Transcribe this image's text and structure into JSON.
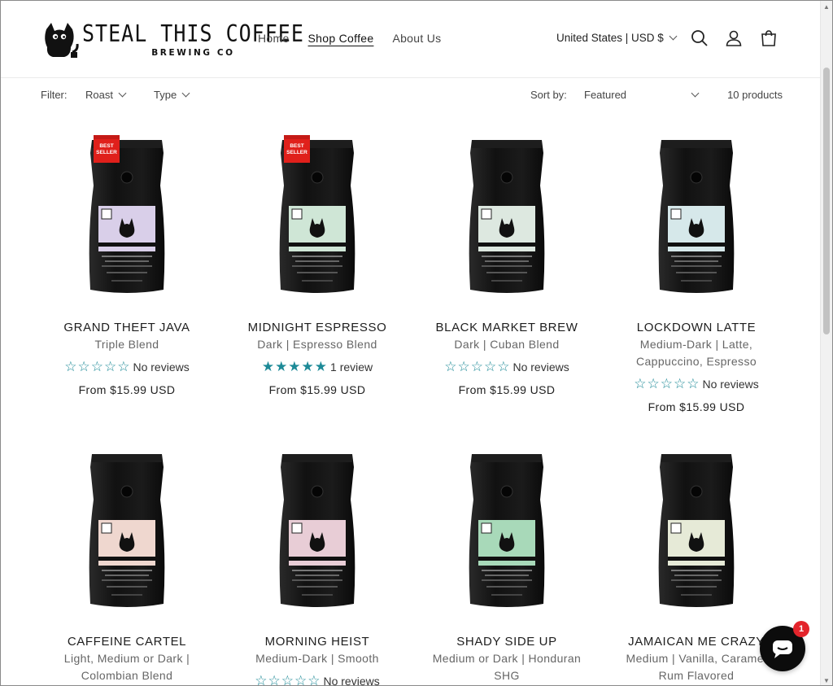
{
  "brand": {
    "title": "STEAL THIS COFFEE",
    "subtitle": "BREWING CO"
  },
  "nav": [
    {
      "label": "Home",
      "active": false
    },
    {
      "label": "Shop Coffee",
      "active": true
    },
    {
      "label": "About Us",
      "active": false
    }
  ],
  "header": {
    "locale": "United States | USD $",
    "icons": [
      "search-icon",
      "account-icon",
      "cart-icon"
    ]
  },
  "filters": {
    "label": "Filter:",
    "roast": "Roast",
    "type": "Type",
    "sort_label": "Sort by:",
    "sort_value": "Featured",
    "count": "10 products"
  },
  "products": [
    {
      "name": "GRAND THEFT JAVA",
      "line1": "Triple Blend",
      "line2": "",
      "stars": "☆☆☆☆☆",
      "reviews": "No reviews",
      "price": "From $15.99 USD",
      "badge": "BEST SELLER",
      "label_color": "#d9cfe9",
      "label_text": "GRAND THEFT JAVA"
    },
    {
      "name": "MIDNIGHT ESPRESSO",
      "line1": "Dark | Espresso Blend",
      "line2": "",
      "stars": "★★★★★",
      "reviews": "1 review",
      "price": "From $15.99 USD",
      "badge": "BEST SELLER",
      "label_color": "#cfe6d6",
      "label_text": "MIDNIGHT ESPRESSO"
    },
    {
      "name": "BLACK MARKET BREW",
      "line1": "Dark | Cuban Blend",
      "line2": "",
      "stars": "☆☆☆☆☆",
      "reviews": "No reviews",
      "price": "From $15.99 USD",
      "badge": "",
      "label_color": "#dde8e0",
      "label_text": "BLACK MARKET BREW"
    },
    {
      "name": "LOCKDOWN LATTE",
      "line1": "Medium-Dark | Latte,",
      "line2": "Cappuccino, Espresso",
      "stars": "☆☆☆☆☆",
      "reviews": "No reviews",
      "price": "From $15.99 USD",
      "badge": "",
      "label_color": "#d6e8ea",
      "label_text": "LOCKDOWN LATTE"
    },
    {
      "name": "CAFFEINE CARTEL",
      "line1": "Light, Medium or Dark |",
      "line2": "Colombian Blend",
      "stars": "",
      "reviews": "",
      "price": "",
      "badge": "",
      "label_color": "#efd7cf",
      "label_text": "CAFFEINE CARTEL"
    },
    {
      "name": "MORNING HEIST",
      "line1": "Medium-Dark | Smooth",
      "line2": "",
      "stars": "☆☆☆☆☆",
      "reviews": "No reviews",
      "price": "",
      "badge": "",
      "label_color": "#e8cdd6",
      "label_text": "MORNING HEIST"
    },
    {
      "name": "SHADY SIDE UP",
      "line1": "Medium or Dark | Honduran",
      "line2": "SHG",
      "stars": "",
      "reviews": "",
      "price": "",
      "badge": "",
      "label_color": "#a8d9b9",
      "label_text": "SHADY SIDE UP"
    },
    {
      "name": "JAMAICAN ME CRAZY",
      "line1": "Medium | Vanilla, Caramel",
      "line2": "Rum Flavored",
      "stars": "",
      "reviews": "",
      "price": "",
      "badge": "",
      "label_color": "#e6ead7",
      "label_text": "JAMAICAN ME CRAZY"
    }
  ],
  "chat": {
    "count": "1"
  }
}
